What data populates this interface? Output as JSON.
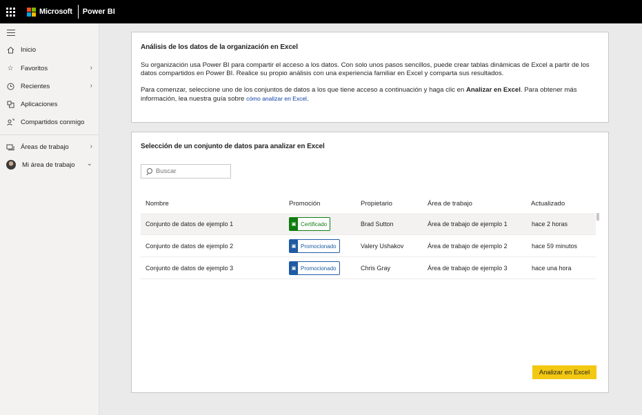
{
  "topbar": {
    "brand": "Microsoft",
    "product": "Power BI",
    "logo_colors": [
      "#f25022",
      "#7fba00",
      "#00a4ef",
      "#ffb900"
    ],
    "icons": [
      "app-launcher-icon"
    ]
  },
  "sidebar": {
    "items": [
      {
        "label": "Inicio",
        "icon": "home-icon"
      },
      {
        "label": "Favoritos",
        "icon": "star-icon"
      },
      {
        "label": "Recientes",
        "icon": "clock-icon"
      },
      {
        "label": "Aplicaciones",
        "icon": "apps-icon"
      },
      {
        "label": "Compartidos conmigo",
        "icon": "shared-icon"
      },
      {
        "label": "Áreas de trabajo",
        "icon": "workspaces-icon"
      },
      {
        "label": "Mi área de trabajo",
        "icon": "avatar"
      }
    ]
  },
  "intro": {
    "title": "Análisis de los datos de la organización en Excel",
    "p1": "Su organización usa Power BI para compartir el acceso a los datos. Con solo unos pasos sencillos, puede crear tablas dinámicas de Excel a partir de los datos compartidos en Power BI. Realice su propio análisis con una experiencia familiar en Excel y comparta sus resultados.",
    "p2_before": "Para comenzar, seleccione uno de los conjuntos de datos a los que tiene acceso a continuación y haga clic en ",
    "p2_bold": "Analizar en Excel",
    "p2_after": ". Para obtener más información, lea nuestra guía sobre ",
    "p2_link": "cómo analizar en Excel",
    "p2_end": "."
  },
  "selection": {
    "title": "Selección de un conjunto de datos para analizar en Excel",
    "search_placeholder": "Buscar",
    "columns": [
      "Nombre",
      "Promoción",
      "Propietario",
      "Área de trabajo",
      "Actualizado"
    ],
    "rows": [
      {
        "name": "Conjunto de datos de ejemplo 1",
        "promotion": "Certificado",
        "owner": "Brad Sutton",
        "workspace": "Área de trabajo de ejemplo 1",
        "updated": "hace 2 horas"
      },
      {
        "name": "Conjunto de datos de ejemplo 2",
        "promotion": "Promocionado",
        "owner": "Valery Ushakov",
        "workspace": "Área de trabajo de ejemplo 2",
        "updated": "hace 59 minutos"
      },
      {
        "name": "Conjunto de datos de ejemplo 3",
        "promotion": "Promocionado",
        "owner": "Chris Gray",
        "workspace": "Área de trabajo de ejemplo 3",
        "updated": "hace una hora"
      }
    ],
    "analyze_button": "Analizar en Excel"
  }
}
